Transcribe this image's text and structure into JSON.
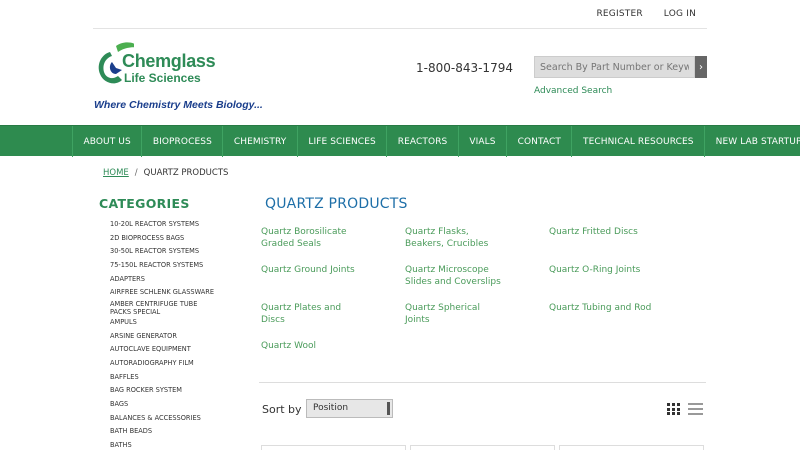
{
  "header": {
    "top_links": [
      "REGISTER",
      "LOG IN"
    ],
    "logo": {
      "name": "Chemglass",
      "sub": "Life Sciences",
      "tagline": "Where Chemistry Meets Biology..."
    },
    "phone": "1-800-843-1794",
    "search": {
      "placeholder": "Search By Part Number or Keyword(s)"
    },
    "advanced_search": "Advanced Search"
  },
  "nav": [
    "ABOUT US",
    "BIOPROCESS",
    "CHEMISTRY",
    "LIFE SCIENCES",
    "REACTORS",
    "VIALS",
    "CONTACT",
    "TECHNICAL RESOURCES",
    "NEW LAB STARTUP"
  ],
  "breadcrumb": {
    "home": "HOME",
    "current": "QUARTZ PRODUCTS"
  },
  "sidebar": {
    "title": "CATEGORIES",
    "items": [
      "10-20L REACTOR SYSTEMS",
      "2D BIOPROCESS BAGS",
      "30-50L REACTOR SYSTEMS",
      "75-150L REACTOR SYSTEMS",
      "ADAPTERS",
      "AIRFREE SCHLENK GLASSWARE",
      "AMBER CENTRIFUGE TUBE PACKS SPECIAL",
      "AMPULS",
      "ARSINE GENERATOR",
      "AUTOCLAVE EQUIPMENT",
      "AUTORADIOGRAPHY FILM",
      "BAFFLES",
      "BAG ROCKER SYSTEM",
      "BAGS",
      "BALANCES & ACCESSORIES",
      "BATH BEADS",
      "BATHS"
    ]
  },
  "main": {
    "title": "QUARTZ PRODUCTS",
    "products": [
      [
        "Quartz Borosilicate",
        "Graded Seals"
      ],
      [
        "Quartz Flasks,",
        "Beakers, Crucibles"
      ],
      [
        "Quartz Fritted Discs"
      ],
      [
        "Quartz Ground Joints"
      ],
      [
        "Quartz Microscope",
        "Slides and Coverslips"
      ],
      [
        "Quartz O-Ring Joints"
      ],
      [
        "Quartz Plates and",
        "Discs"
      ],
      [
        "Quartz Spherical",
        "Joints"
      ],
      [
        "Quartz Tubing and Rod"
      ],
      [
        "Quartz Wool"
      ]
    ],
    "sort_label": "Sort by",
    "sort_value": "Position"
  }
}
